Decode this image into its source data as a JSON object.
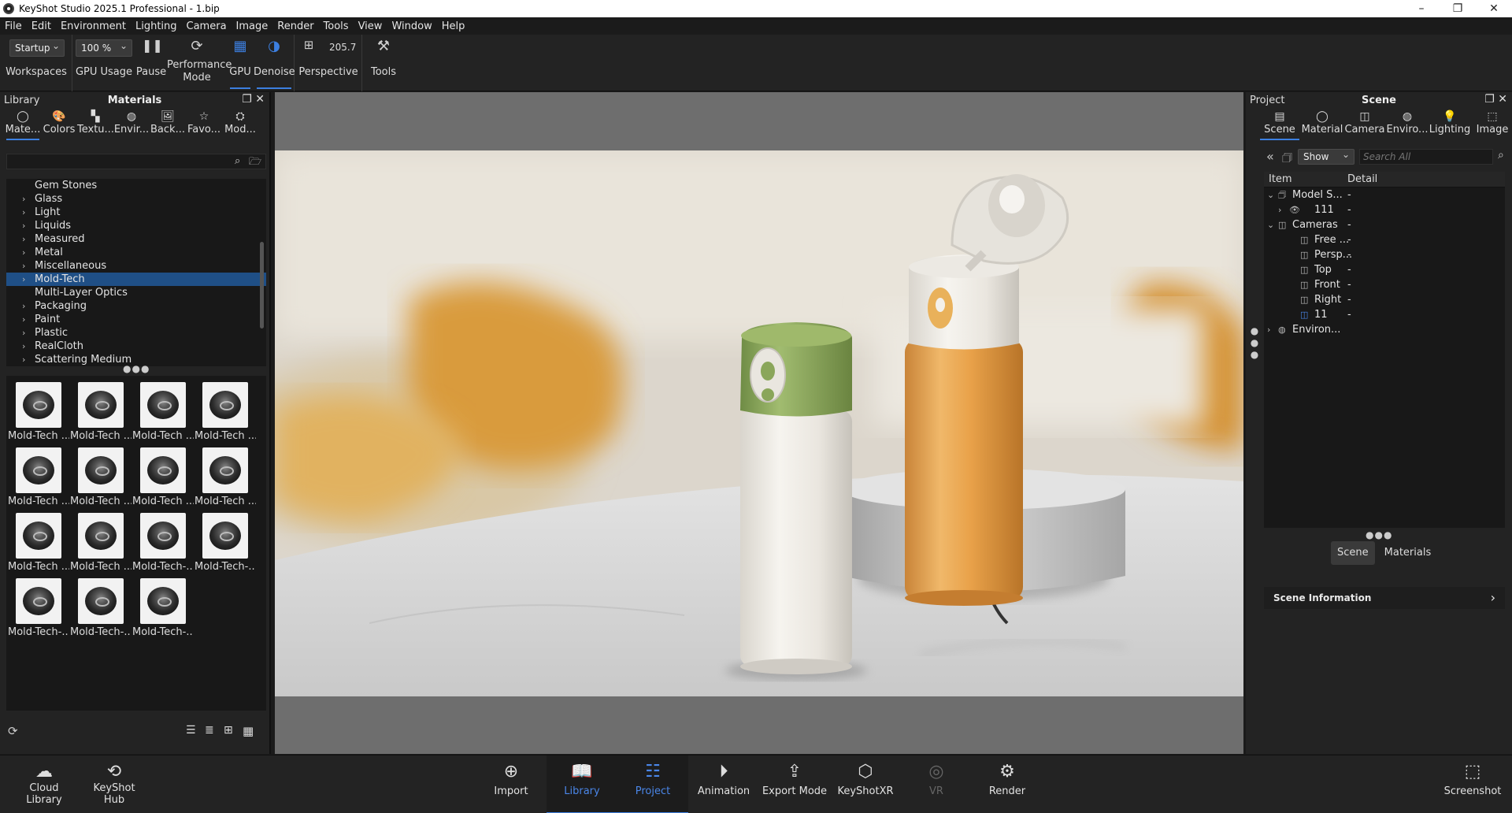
{
  "window": {
    "title": "KeyShot Studio 2025.1 Professional  - 1.bip"
  },
  "menu": [
    "File",
    "Edit",
    "Environment",
    "Lighting",
    "Camera",
    "Image",
    "Render",
    "Tools",
    "View",
    "Window",
    "Help"
  ],
  "toolbar": {
    "workspace_select": "Startup",
    "workspaces_label": "Workspaces",
    "gpu_usage_select": "100 %",
    "gpu_usage_label": "GPU Usage",
    "pause_label": "Pause",
    "performance_label_1": "Performance",
    "performance_label_2": "Mode",
    "gpu_label": "GPU",
    "denoise_label": "Denoise",
    "focal_value": "205.7",
    "perspective_label": "Perspective",
    "tools_label": "Tools"
  },
  "library": {
    "title": "Library",
    "center_title": "Materials",
    "tabs": [
      "Mate...",
      "Colors",
      "Textu...",
      "Envir...",
      "Back...",
      "Favo...",
      "Mod..."
    ],
    "tree": [
      {
        "label": "Gem Stones",
        "expandable": false
      },
      {
        "label": "Glass",
        "expandable": true
      },
      {
        "label": "Light",
        "expandable": true
      },
      {
        "label": "Liquids",
        "expandable": true
      },
      {
        "label": "Measured",
        "expandable": true
      },
      {
        "label": "Metal",
        "expandable": true
      },
      {
        "label": "Miscellaneous",
        "expandable": true
      },
      {
        "label": "Mold-Tech",
        "expandable": true,
        "selected": true
      },
      {
        "label": "Multi-Layer Optics",
        "expandable": false
      },
      {
        "label": "Packaging",
        "expandable": true
      },
      {
        "label": "Paint",
        "expandable": true
      },
      {
        "label": "Plastic",
        "expandable": true
      },
      {
        "label": "RealCloth",
        "expandable": true
      },
      {
        "label": "Scattering Medium",
        "expandable": true
      }
    ],
    "thumbnails": [
      "Mold-Tech ...",
      "Mold-Tech ...",
      "Mold-Tech ...",
      "Mold-Tech ...",
      "Mold-Tech ...",
      "Mold-Tech ...",
      "Mold-Tech ...",
      "Mold-Tech ...",
      "Mold-Tech ...",
      "Mold-Tech ...",
      "Mold-Tech-...",
      "Mold-Tech-...",
      "Mold-Tech-...",
      "Mold-Tech-...",
      "Mold-Tech-..."
    ]
  },
  "project": {
    "title": "Project",
    "center_title": "Scene",
    "tabs": [
      "Scene",
      "Material",
      "Camera",
      "Enviro...",
      "Lighting",
      "Image"
    ],
    "show_select": "Show",
    "search_placeholder": "Search All",
    "col_item": "Item",
    "col_detail": "Detail",
    "rows": [
      {
        "label": "Model S...",
        "detail": "-",
        "indent": 0,
        "arrow": "⌄",
        "icon": "🗇"
      },
      {
        "label": "111",
        "detail": "-",
        "indent": 1,
        "arrow": "›",
        "icon": "👁"
      },
      {
        "label": "Cameras",
        "detail": "-",
        "indent": 0,
        "arrow": "⌄",
        "icon": "◫"
      },
      {
        "label": "Free ...",
        "detail": "-",
        "indent": 2,
        "arrow": "",
        "icon": "◫"
      },
      {
        "label": "Persp...",
        "detail": "-",
        "indent": 2,
        "arrow": "",
        "icon": "◫"
      },
      {
        "label": "Top",
        "detail": "-",
        "indent": 2,
        "arrow": "",
        "icon": "◫"
      },
      {
        "label": "Front",
        "detail": "-",
        "indent": 2,
        "arrow": "",
        "icon": "◫"
      },
      {
        "label": "Right",
        "detail": "-",
        "indent": 2,
        "arrow": "",
        "icon": "◫"
      },
      {
        "label": "11",
        "detail": "-",
        "indent": 2,
        "arrow": "",
        "icon": "◫"
      },
      {
        "label": "Environ...",
        "detail": "",
        "indent": 0,
        "arrow": "›",
        "icon": "◍"
      }
    ],
    "bottom_tabs": [
      "Scene",
      "Materials"
    ],
    "scene_info": "Scene Information"
  },
  "bottombar": {
    "cloud_1": "Cloud",
    "cloud_2": "Library",
    "hub_1": "KeyShot",
    "hub_2": "Hub",
    "import": "Import",
    "library": "Library",
    "project": "Project",
    "animation": "Animation",
    "export": "Export Mode",
    "xr": "KeyShotXR",
    "vr": "VR",
    "render": "Render",
    "screenshot": "Screenshot"
  },
  "colors": {
    "accent": "#3c7fe0",
    "selection": "#1f4f86",
    "bottle_green": "#8aa65a",
    "bottle_orange": "#e7a24e"
  }
}
